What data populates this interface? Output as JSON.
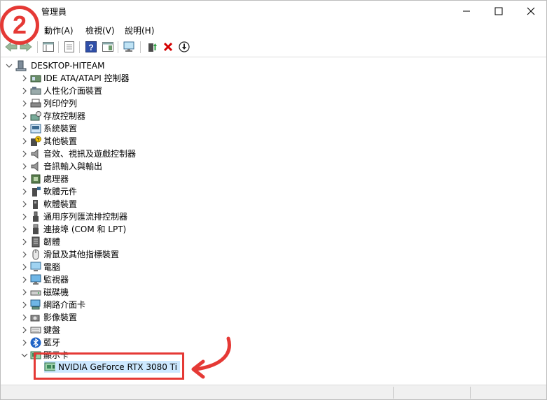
{
  "window": {
    "title": "管理員",
    "controls": {
      "minimize": "—",
      "maximize": "☐",
      "close": "✕"
    }
  },
  "step_badge": "2",
  "menu": [
    {
      "label": "動作(A)"
    },
    {
      "label": "檢視(V)"
    },
    {
      "label": "說明(H)"
    }
  ],
  "toolbar": [
    {
      "icon": "back-arrow-icon"
    },
    {
      "icon": "forward-arrow-icon"
    },
    {
      "icon": "console-tree-icon"
    },
    {
      "icon": "properties-icon"
    },
    {
      "icon": "help-icon"
    },
    {
      "icon": "action-pane-icon"
    },
    {
      "icon": "scan-hardware-icon"
    },
    {
      "icon": "update-driver-icon"
    },
    {
      "icon": "uninstall-device-icon"
    },
    {
      "icon": "disable-device-icon"
    }
  ],
  "tree": {
    "root": "DESKTOP-HITEAM",
    "categories": [
      {
        "label": "IDE ATA/ATAPI 控制器",
        "icon": "ide-controller-icon"
      },
      {
        "label": "人性化介面裝置",
        "icon": "hid-icon"
      },
      {
        "label": "列印佇列",
        "icon": "printer-icon"
      },
      {
        "label": "存放控制器",
        "icon": "storage-controller-icon"
      },
      {
        "label": "系統裝置",
        "icon": "system-device-icon"
      },
      {
        "label": "其他裝置",
        "icon": "unknown-device-icon"
      },
      {
        "label": "音效、視訊及遊戲控制器",
        "icon": "speaker-icon"
      },
      {
        "label": "音訊輸入與輸出",
        "icon": "speaker-icon"
      },
      {
        "label": "處理器",
        "icon": "processor-icon"
      },
      {
        "label": "軟體元件",
        "icon": "software-component-icon"
      },
      {
        "label": "軟體裝置",
        "icon": "software-device-icon"
      },
      {
        "label": "通用序列匯流排控制器",
        "icon": "usb-icon"
      },
      {
        "label": "連接埠 (COM 和 LPT)",
        "icon": "port-icon"
      },
      {
        "label": "韌體",
        "icon": "firmware-icon"
      },
      {
        "label": "滑鼠及其他指標裝置",
        "icon": "mouse-icon"
      },
      {
        "label": "電腦",
        "icon": "computer-icon"
      },
      {
        "label": "監視器",
        "icon": "monitor-icon"
      },
      {
        "label": "磁碟機",
        "icon": "disk-drive-icon"
      },
      {
        "label": "網路介面卡",
        "icon": "network-adapter-icon"
      },
      {
        "label": "影像裝置",
        "icon": "camera-icon"
      },
      {
        "label": "鍵盤",
        "icon": "keyboard-icon"
      },
      {
        "label": "藍牙",
        "icon": "bluetooth-icon"
      },
      {
        "label": "顯示卡",
        "icon": "display-adapter-icon"
      }
    ],
    "expanded_child": {
      "label": "NVIDIA GeForce RTX 3080 Ti",
      "icon": "display-adapter-icon"
    }
  },
  "colors": {
    "highlight": "#e53935",
    "selection": "#cce8ff"
  }
}
